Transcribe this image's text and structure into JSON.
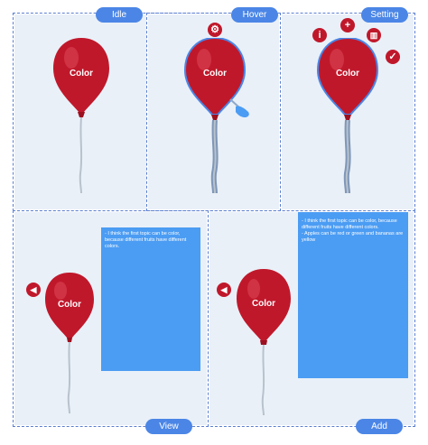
{
  "states": {
    "idle": "Idle",
    "hover": "Hover",
    "setting": "Setting",
    "view": "View",
    "add": "Add"
  },
  "balloon_label": "Color",
  "icons": {
    "hover_settings": "gear-icon",
    "setting_info": "info-icon",
    "setting_add": "plus-icon",
    "setting_delete": "trash-icon",
    "setting_confirm": "check-icon",
    "view_back": "back-arrow-icon",
    "add_back": "back-arrow-icon",
    "hover_hand": "hand-pointer-icon"
  },
  "notes": {
    "view": [
      "- I think the first topic can be color, because different fruits have different colors."
    ],
    "add": [
      "- I think the first topic can be color, because different fruits have different colors.",
      "- Apples can be red or green and bananas are yellow"
    ]
  },
  "colors": {
    "balloon": "#c0182b",
    "pill": "#4b86e6",
    "note": "#4b9cf3",
    "panel": "#e9f0f8"
  }
}
